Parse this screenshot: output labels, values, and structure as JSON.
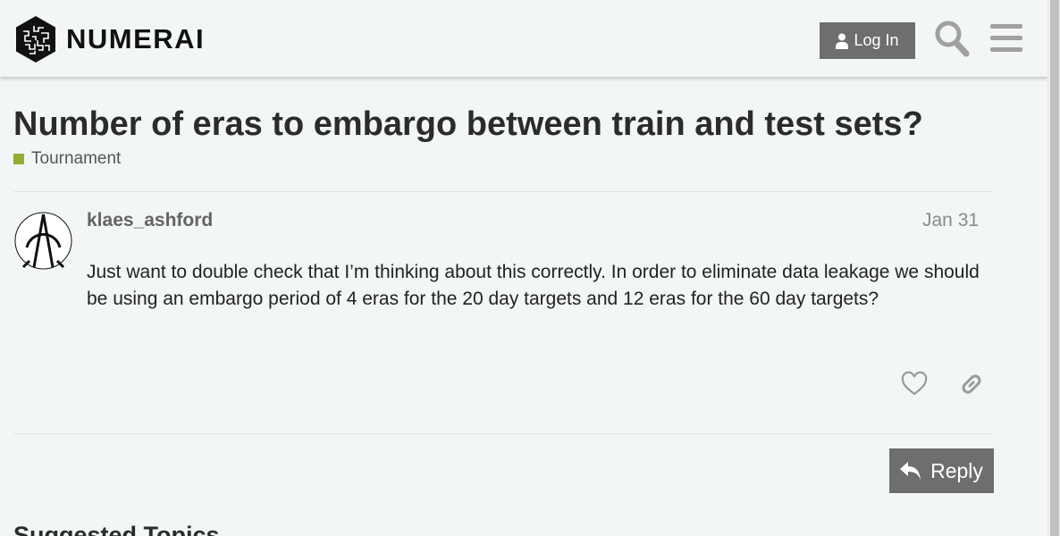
{
  "header": {
    "brand": "NUMERAI",
    "login_label": "Log In"
  },
  "topic": {
    "title": "Number of eras to embargo between train and test sets?",
    "category": "Tournament",
    "category_color": "#8fae2e"
  },
  "post": {
    "username": "klaes_ashford",
    "date": "Jan 31",
    "body": "Just want to double check that I’m thinking about this correctly. In order to eliminate data leakage we should be using an embargo period of 4 eras for the 20 day targets and 12 eras for the 60 day targets?"
  },
  "actions": {
    "reply_label": "Reply"
  },
  "suggested": {
    "heading": "Suggested Topics"
  },
  "icons": {
    "logo": "numerai-logo-icon",
    "user": "user-icon",
    "search": "search-icon",
    "menu": "hamburger-menu-icon",
    "like": "heart-icon",
    "share": "link-icon",
    "reply": "reply-arrow-icon"
  },
  "colors": {
    "button": "#6e6e6e",
    "background": "#f3f6f7"
  }
}
